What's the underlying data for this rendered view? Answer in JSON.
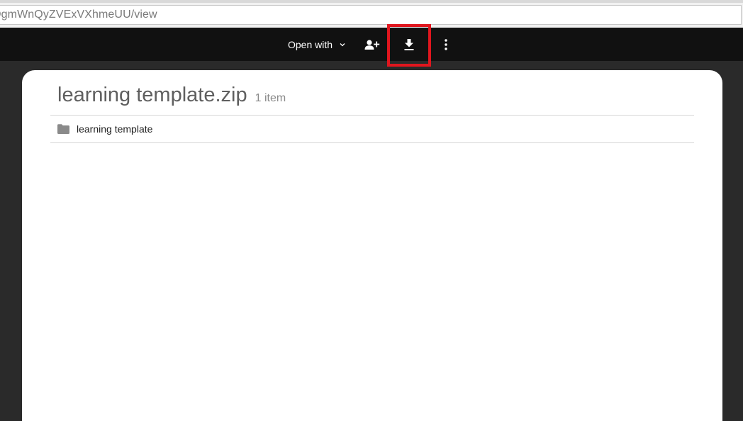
{
  "browser": {
    "url_text": "DgmWnQyZVExVXhmeUU/view"
  },
  "toolbar": {
    "open_with_label": "Open with",
    "icons": {
      "open_with_chevron": "chevron-down-icon",
      "add_person": "person-add-icon",
      "download": "download-icon",
      "more": "more-vertical-icon"
    },
    "highlight_color": "#e0161e"
  },
  "archive": {
    "title": "learning template.zip",
    "item_count": "1 item",
    "items": [
      {
        "name": "learning template",
        "icon": "folder-icon"
      }
    ]
  },
  "colors": {
    "toolbar_bg": "#111111",
    "page_bg": "#2a2a2a",
    "card_bg": "#ffffff"
  }
}
